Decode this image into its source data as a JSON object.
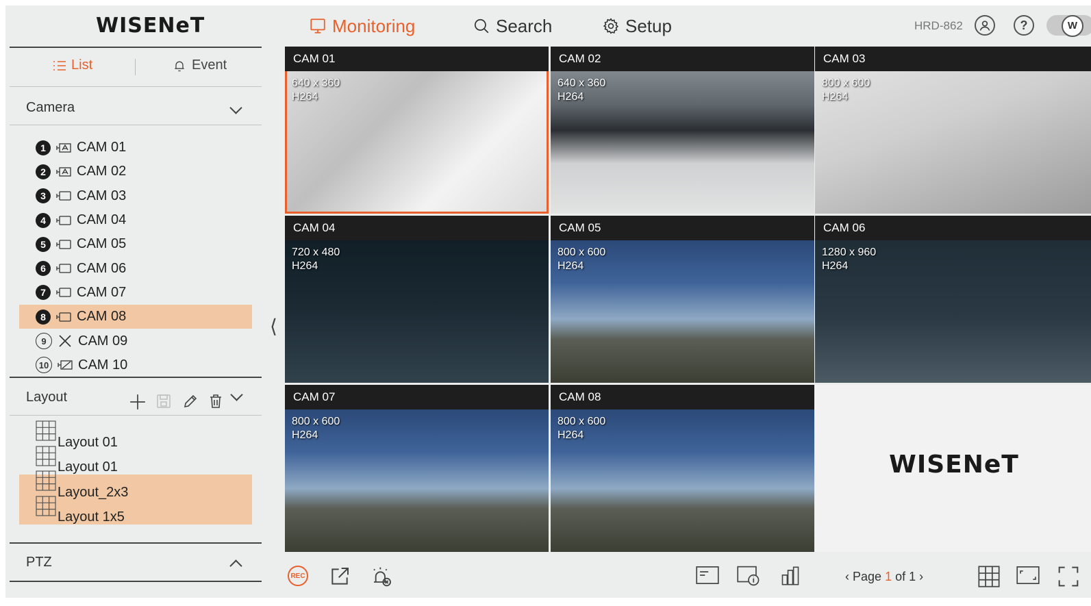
{
  "header": {
    "logo": "WISENeT",
    "nav": [
      {
        "label": "Monitoring",
        "icon": "monitor-icon",
        "active": true
      },
      {
        "label": "Search",
        "icon": "search-icon",
        "active": false
      },
      {
        "label": "Setup",
        "icon": "gear-icon",
        "active": false
      }
    ],
    "model": "HRD-862",
    "toggle_label": "W"
  },
  "sidebar": {
    "tabs": [
      {
        "label": "List",
        "icon": "list-icon",
        "active": true
      },
      {
        "label": "Event",
        "icon": "bell-icon",
        "active": false
      }
    ],
    "camera_section": "Camera",
    "cameras": [
      {
        "num": "1",
        "label": "CAM 01",
        "type": "ptz",
        "selected": false,
        "disconnected": false
      },
      {
        "num": "2",
        "label": "CAM 02",
        "type": "ptz",
        "selected": false,
        "disconnected": false
      },
      {
        "num": "3",
        "label": "CAM 03",
        "type": "bullet",
        "selected": false,
        "disconnected": false
      },
      {
        "num": "4",
        "label": "CAM 04",
        "type": "bullet",
        "selected": false,
        "disconnected": false
      },
      {
        "num": "5",
        "label": "CAM 05",
        "type": "bullet",
        "selected": false,
        "disconnected": false
      },
      {
        "num": "6",
        "label": "CAM 06",
        "type": "bullet",
        "selected": false,
        "disconnected": false
      },
      {
        "num": "7",
        "label": "CAM 07",
        "type": "bullet",
        "selected": false,
        "disconnected": false
      },
      {
        "num": "8",
        "label": "CAM 08",
        "type": "bullet",
        "selected": true,
        "disconnected": false
      },
      {
        "num": "9",
        "label": "CAM 09",
        "type": "none",
        "selected": false,
        "disconnected": true
      },
      {
        "num": "10",
        "label": "CAM 10",
        "type": "ptz-off",
        "selected": false,
        "disconnected": true
      }
    ],
    "layout_section": "Layout",
    "layouts": [
      {
        "label": "Layout 01",
        "selected": false
      },
      {
        "label": "Layout 01",
        "selected": false
      },
      {
        "label": "Layout_2x3",
        "selected": true
      },
      {
        "label": "Layout 1x5",
        "selected": true
      }
    ],
    "ptz_section": "PTZ"
  },
  "tiles": [
    {
      "title": "CAM 01",
      "resolution": "640 x 360",
      "codec": "H264",
      "scene": "cables",
      "active": true
    },
    {
      "title": "CAM 02",
      "resolution": "640 x 360",
      "codec": "H264",
      "scene": "office",
      "active": false
    },
    {
      "title": "CAM 03",
      "resolution": "800 x 600",
      "codec": "H264",
      "scene": "ceiling",
      "active": false
    },
    {
      "title": "CAM 04",
      "resolution": "720 x 480",
      "codec": "H264",
      "scene": "dark",
      "active": false
    },
    {
      "title": "CAM 05",
      "resolution": "800 x 600",
      "codec": "H264",
      "scene": "city",
      "active": false
    },
    {
      "title": "CAM 06",
      "resolution": "1280 x 960",
      "codec": "H264",
      "scene": "office2",
      "active": false
    },
    {
      "title": "CAM 07",
      "resolution": "800 x 600",
      "codec": "H264",
      "scene": "city",
      "active": false
    },
    {
      "title": "CAM 08",
      "resolution": "800 x 600",
      "codec": "H264",
      "scene": "city",
      "active": false
    }
  ],
  "empty_tile_logo": "WISENeT",
  "toolbar": {
    "rec_label": "REC",
    "page_prefix": "Page",
    "page_current": "1",
    "page_of": "of 1",
    "colors": {
      "accent": "#e8612c",
      "selected_bg": "#f1c8a3"
    }
  }
}
